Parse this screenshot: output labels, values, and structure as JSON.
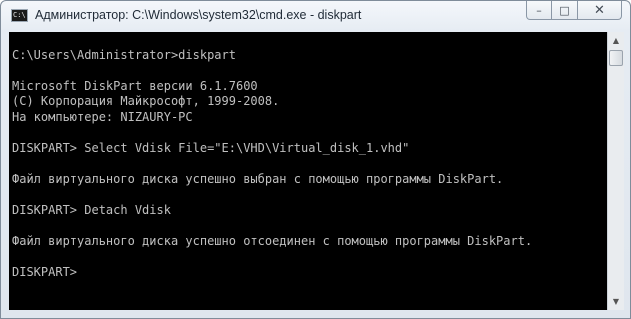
{
  "window": {
    "title": "Администратор: C:\\Windows\\system32\\cmd.exe - diskpart",
    "icon": "cmd-icon",
    "icon_text": "C:\\"
  },
  "caption_buttons": {
    "minimize": "–",
    "maximize": "□",
    "close": "✕"
  },
  "console": {
    "lines": [
      "",
      "C:\\Users\\Administrator>diskpart",
      "",
      "Microsoft DiskPart версии 6.1.7600",
      "(C) Корпорация Майкрософт, 1999-2008.",
      "На компьютере: NIZAURY-PC",
      "",
      "DISKPART> Select Vdisk File=\"E:\\VHD\\Virtual_disk_1.vhd\"",
      "",
      "Файл виртуального диска успешно выбран с помощью программы DiskPart.",
      "",
      "DISKPART> Detach Vdisk",
      "",
      "Файл виртуального диска успешно отсоединен с помощью программы DiskPart.",
      "",
      "DISKPART> ",
      ""
    ]
  },
  "scrollbar": {
    "up_arrow": "▲",
    "down_arrow": "▼"
  },
  "colors": {
    "console_bg": "#000000",
    "console_fg": "#c0c0c0"
  }
}
